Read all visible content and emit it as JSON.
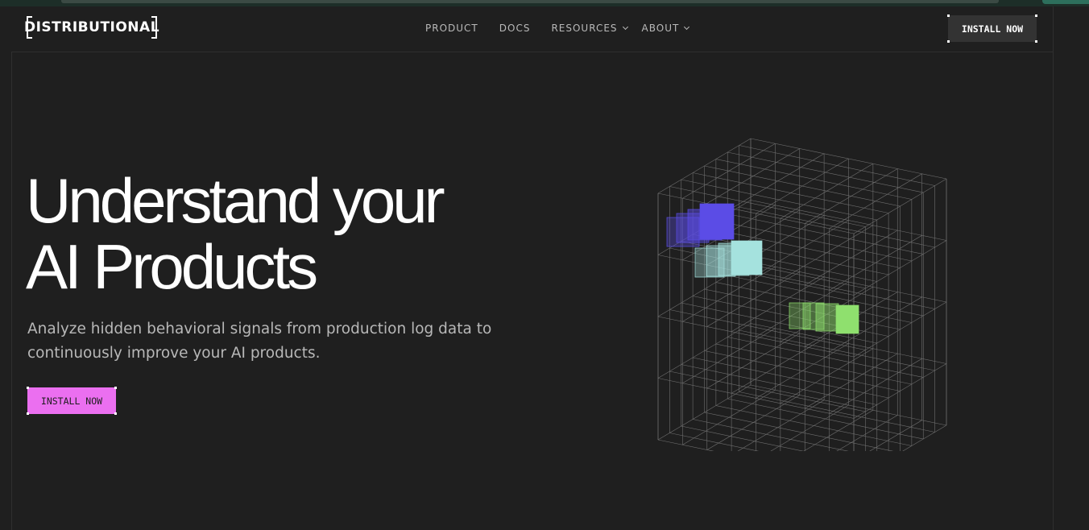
{
  "brand": {
    "logo_text": "DISTRIBUTIONAL"
  },
  "nav": {
    "items": [
      {
        "label": "PRODUCT",
        "has_dropdown": false
      },
      {
        "label": "DOCS",
        "has_dropdown": false
      },
      {
        "label": "RESOURCES",
        "has_dropdown": true
      },
      {
        "label": "ABOUT",
        "has_dropdown": true
      }
    ],
    "cta_label": "INSTALL NOW"
  },
  "hero": {
    "headline_line1": "Understand your",
    "headline_line2": "AI Products",
    "subtitle_line1": "Analyze hidden behavioral signals from production log data to",
    "subtitle_line2": "continuously improve your AI products.",
    "cta_label": "INSTALL NOW"
  },
  "colors": {
    "background": "#1f1f1f",
    "cta_pink": "#eb6ff0",
    "block_purple": "#5b4ce6",
    "block_teal": "#a5e2de",
    "block_green": "#8fe06e"
  },
  "icons": [
    "chevron-down-icon"
  ]
}
